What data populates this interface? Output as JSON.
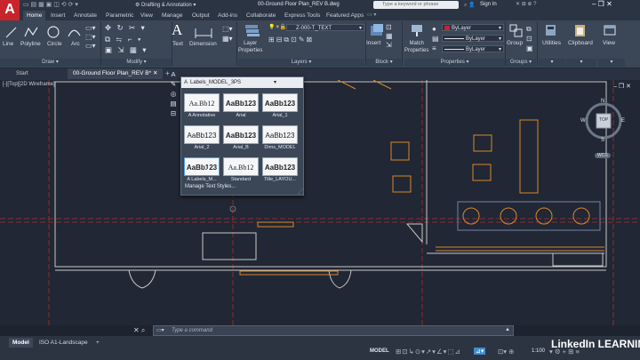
{
  "app": {
    "logo_letter": "A",
    "title": "00-Ground Floor Plan_REV B.dwg",
    "workspace": "Drafting & Annotation",
    "search_placeholder": "Type a keyword or phrase",
    "sign_in": "Sign In"
  },
  "ribbon_tabs": [
    "Home",
    "Insert",
    "Annotate",
    "Parametric",
    "View",
    "Manage",
    "Output",
    "Add-ins",
    "Collaborate",
    "Express Tools",
    "Featured Apps"
  ],
  "ribbon": {
    "draw": {
      "tools": [
        "Line",
        "Polyline",
        "Circle",
        "Arc"
      ],
      "title": "Draw"
    },
    "modify": {
      "title": "Modify"
    },
    "annotation": {
      "text": "Text",
      "dimension": "Dimension"
    },
    "layers": {
      "properties_label": "Layer Properties",
      "current_layer": "Z-000-T_TEXT",
      "title": "Layers"
    },
    "block": {
      "insert": "Insert",
      "title": "Block"
    },
    "properties": {
      "match": "Match Properties",
      "bylayer1": "ByLayer",
      "bylayer2": "ByLayer",
      "bylayer3": "ByLayer",
      "title": "Properties"
    },
    "groups": {
      "label": "Group",
      "title": "Groups"
    },
    "utilities": "Utilities",
    "clipboard": "Clipboard",
    "view": "View"
  },
  "doc_tabs": [
    "Start",
    "00-Ground Floor Plan_REV B*"
  ],
  "viewport_label": "[-][Top][2D Wireframe]",
  "text_style_gallery": {
    "current": "Labels_MODEL_3PS",
    "styles": [
      {
        "preview": "Aa.Bb12",
        "name": "Annotative"
      },
      {
        "preview": "AaBb123",
        "name": "Arial"
      },
      {
        "preview": "AaBb123",
        "name": "Arial_1"
      },
      {
        "preview": "AaBb123",
        "name": "Arial_2"
      },
      {
        "preview": "AaBb123",
        "name": "Arial_B"
      },
      {
        "preview": "AaBb123",
        "name": "Dims_MODEL"
      },
      {
        "preview": "AaBb123",
        "name": "Labels_M..."
      },
      {
        "preview": "Aa.Bb12",
        "name": "Standard"
      },
      {
        "preview": "AaBb123",
        "name": "Title_LAYOU..."
      }
    ],
    "manage_label": "Manage Text Styles..."
  },
  "viewcube": {
    "top": "TOP",
    "n": "N",
    "s": "S",
    "e": "E",
    "w": "W",
    "wcs": "WCS"
  },
  "command": {
    "placeholder": "Type a command"
  },
  "layout_tabs": [
    "Model",
    "ISO A1-Landscape"
  ],
  "status": {
    "model": "MODEL",
    "scale": "1:100"
  },
  "watermark": "LinkedIn LEARNING",
  "colors": {
    "accent": "#c8242b",
    "background": "#212734",
    "ribbon": "#3b4656",
    "walls": "#c8c8c8",
    "furniture": "#d88a2c",
    "gridlines": "#b03030"
  }
}
